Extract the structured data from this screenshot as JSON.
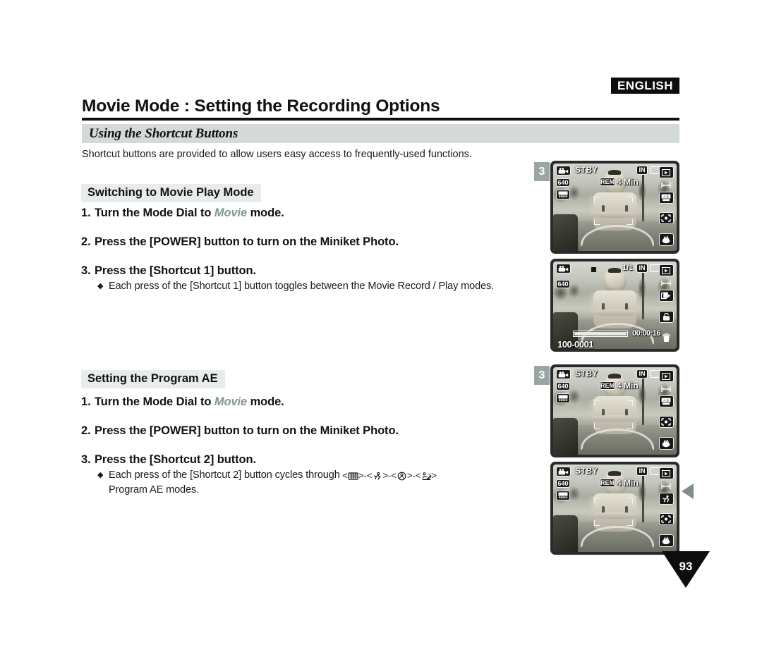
{
  "header": {
    "language_badge": "ENGLISH",
    "title": "Movie Mode : Setting the Recording Options",
    "section_banner": "Using the Shortcut Buttons"
  },
  "intro": {
    "text": "Shortcut buttons are provided to allow users easy access to frequently-used functions."
  },
  "sections": [
    {
      "heading": "Switching to Movie Play Mode",
      "steps": [
        {
          "num": "1.",
          "before": "Turn the Mode Dial to ",
          "emphasis": "Movie",
          "after": " mode."
        },
        {
          "num": "2.",
          "before": "Press the [POWER] button to turn on the Miniket Photo.",
          "emphasis": "",
          "after": ""
        },
        {
          "num": "3.",
          "before": "Press the [Shortcut 1] button.",
          "emphasis": "",
          "after": ""
        }
      ],
      "bullets": [
        "Each press of the [Shortcut 1] button toggles between the Movie Record / Play modes."
      ]
    },
    {
      "heading": "Setting the Program AE",
      "steps": [
        {
          "num": "1.",
          "before": "Turn the Mode Dial to ",
          "emphasis": "Movie",
          "after": " mode."
        },
        {
          "num": "2.",
          "before": "Press the [POWER] button to turn on the Miniket Photo.",
          "emphasis": "",
          "after": ""
        },
        {
          "num": "3.",
          "before": "Press the [Shortcut 2] button.",
          "emphasis": "",
          "after": ""
        }
      ],
      "bullets": [
        "Each press of the [Shortcut 2] button cycles through",
        "Program AE modes."
      ],
      "ae_icons": [
        "auto-program-ae-icon",
        "sports-program-ae-icon",
        "spotlight-program-ae-icon",
        "sand-snow-program-ae-icon"
      ],
      "ae_separator": "-"
    }
  ],
  "lcd_panels": [
    {
      "id": "movie-record-standby-1",
      "step_marker": "3",
      "status": "STBY",
      "resolution": "640",
      "remaining_label": "REM",
      "remaining_value": "4 Min",
      "memory": "IN",
      "icons": {
        "mode": "camcorder-icon",
        "quality": "quality-icon",
        "play": "play-mode-icon",
        "zoom": "zoom-icon",
        "backlight": "backlight-icon",
        "focus": "focus-icon",
        "program_ae": "program-ae-icon"
      }
    },
    {
      "id": "movie-play",
      "step_marker": "",
      "status": "",
      "resolution": "640",
      "counter": "1/1",
      "file_number": "100-0001",
      "timecode": "00:00:16",
      "memory": "IN",
      "icons": {
        "mode": "camcorder-icon",
        "stop": "stop-icon",
        "play": "play-mode-icon",
        "zoom": "zoom-icon",
        "multi": "multi-view-icon",
        "lock": "lock-icon",
        "delete": "trash-icon"
      }
    },
    {
      "id": "movie-record-standby-2",
      "step_marker": "3",
      "status": "STBY",
      "resolution": "640",
      "remaining_label": "REM",
      "remaining_value": "4 Min",
      "memory": "IN",
      "icons": {
        "mode": "camcorder-icon",
        "quality": "quality-icon",
        "play": "play-mode-icon",
        "zoom": "zoom-icon",
        "backlight": "backlight-icon",
        "focus": "focus-icon",
        "program_ae": "program-ae-icon"
      }
    },
    {
      "id": "movie-record-program-ae-selected",
      "step_marker": "",
      "status": "STBY",
      "resolution": "640",
      "remaining_label": "REM",
      "remaining_value": "4 Min",
      "memory": "IN",
      "selected_icon": "sports-program-ae-icon",
      "icons": {
        "mode": "camcorder-icon",
        "quality": "quality-icon",
        "play": "play-mode-icon",
        "zoom": "zoom-icon",
        "sports": "sports-program-ae-icon",
        "focus": "focus-icon",
        "program_ae": "program-ae-icon"
      }
    }
  ],
  "footer": {
    "page_number": "93"
  },
  "colors": {
    "banner_bg": "#d3dad8",
    "subhead_bg": "#e8ecec",
    "emphasis": "#7f9695",
    "badge_bg": "#0d0d0d",
    "marker_bg": "#9aa6a3",
    "arrow": "#7f8d8c"
  }
}
